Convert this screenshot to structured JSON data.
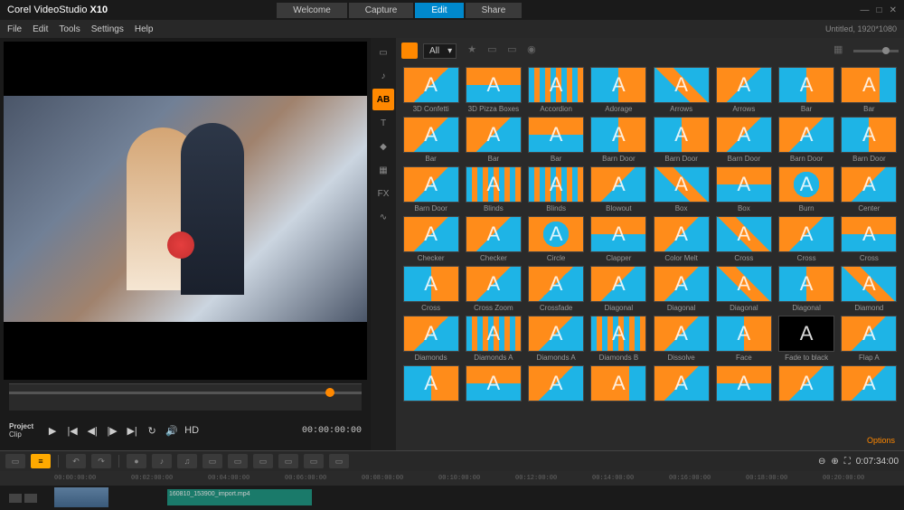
{
  "app": {
    "brand": "Corel",
    "name": "VideoStudio",
    "version": "X10"
  },
  "top_tabs": [
    "Welcome",
    "Capture",
    "Edit",
    "Share"
  ],
  "active_top_tab": "Edit",
  "menu": [
    "File",
    "Edit",
    "Tools",
    "Settings",
    "Help"
  ],
  "project_info": "Untitled, 1920*1080",
  "playback": {
    "mode_label": "Project",
    "sub_label": "Clip",
    "timecode": "00:00:00:00",
    "hd_label": "HD"
  },
  "library": {
    "filter": "All",
    "options_label": "Options",
    "vtabs": [
      "media",
      "sound",
      "transitions",
      "title",
      "graphics",
      "filters",
      "fx",
      "path"
    ],
    "active_vtab": "transitions",
    "items": [
      {
        "label": "3D Confetti",
        "v": 0
      },
      {
        "label": "3D Pizza Boxes",
        "v": 2
      },
      {
        "label": "Accordion",
        "v": 4
      },
      {
        "label": "Adorage",
        "v": 3
      },
      {
        "label": "Arrows",
        "v": 6
      },
      {
        "label": "Arrows",
        "v": 0
      },
      {
        "label": "Bar",
        "v": 3
      },
      {
        "label": "Bar",
        "v": 7
      },
      {
        "label": "Bar",
        "v": 0
      },
      {
        "label": "Bar",
        "v": 0
      },
      {
        "label": "Bar",
        "v": 2
      },
      {
        "label": "Barn Door",
        "v": 3
      },
      {
        "label": "Barn Door",
        "v": 3
      },
      {
        "label": "Barn Door",
        "v": 0
      },
      {
        "label": "Barn Door",
        "v": 0
      },
      {
        "label": "Barn Door",
        "v": 3
      },
      {
        "label": "Barn Door",
        "v": 0
      },
      {
        "label": "Blinds",
        "v": 4
      },
      {
        "label": "Blinds",
        "v": 4
      },
      {
        "label": "Blowout",
        "v": 0
      },
      {
        "label": "Box",
        "v": 6
      },
      {
        "label": "Box",
        "v": 2
      },
      {
        "label": "Burn",
        "v": 1
      },
      {
        "label": "Center",
        "v": 0
      },
      {
        "label": "Checker",
        "v": 0
      },
      {
        "label": "Checker",
        "v": 0
      },
      {
        "label": "Circle",
        "v": 1
      },
      {
        "label": "Clapper",
        "v": 2
      },
      {
        "label": "Color Melt",
        "v": 0
      },
      {
        "label": "Cross",
        "v": 6
      },
      {
        "label": "Cross",
        "v": 0
      },
      {
        "label": "Cross",
        "v": 2
      },
      {
        "label": "Cross",
        "v": 3
      },
      {
        "label": "Cross Zoom",
        "v": 0
      },
      {
        "label": "Crossfade",
        "v": 0
      },
      {
        "label": "Diagonal",
        "v": 0
      },
      {
        "label": "Diagonal",
        "v": 0
      },
      {
        "label": "Diagonal",
        "v": 6
      },
      {
        "label": "Diagonal",
        "v": 3
      },
      {
        "label": "Diamond",
        "v": 6
      },
      {
        "label": "Diamonds",
        "v": 0
      },
      {
        "label": "Diamonds A",
        "v": 4
      },
      {
        "label": "Diamonds A",
        "v": 0
      },
      {
        "label": "Diamonds B",
        "v": 4
      },
      {
        "label": "Dissolve",
        "v": 0
      },
      {
        "label": "Face",
        "v": 3
      },
      {
        "label": "Fade to black",
        "v": 5
      },
      {
        "label": "Flap A",
        "v": 0
      },
      {
        "label": "",
        "v": 3
      },
      {
        "label": "",
        "v": 2
      },
      {
        "label": "",
        "v": 0
      },
      {
        "label": "",
        "v": 7
      },
      {
        "label": "",
        "v": 0
      },
      {
        "label": "",
        "v": 2
      },
      {
        "label": "",
        "v": 0
      },
      {
        "label": "",
        "v": 0
      }
    ]
  },
  "timeline": {
    "timecode": "0:07:34:00",
    "ruler": [
      "00:00:00:00",
      "00:02:00:00",
      "00:04:00:00",
      "00:06:00:00",
      "00:08:00:00",
      "00:10:00:00",
      "00:12:00:00",
      "00:14:00:00",
      "00:16:00:00",
      "00:18:00:00",
      "00:20:00:00"
    ],
    "clip_name": "160810_153900_import.mp4"
  }
}
